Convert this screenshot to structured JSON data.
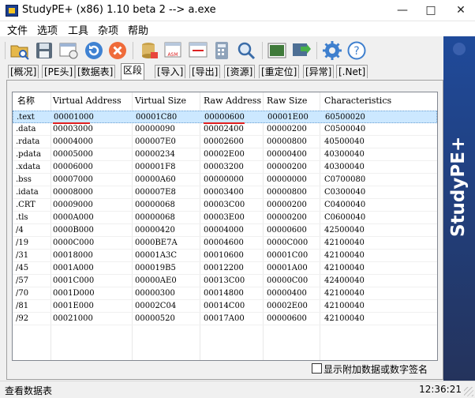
{
  "window": {
    "title": "StudyPE+ (x86) 1.10 beta 2  --> a.exe",
    "minimize": "—",
    "maximize": "□",
    "close": "✕"
  },
  "menu": [
    "文件",
    "选项",
    "工具",
    "杂项",
    "帮助"
  ],
  "toolbar": {
    "buttons": [
      {
        "name": "open-file",
        "icon": "folder-icon"
      },
      {
        "name": "save",
        "icon": "floppy-icon"
      },
      {
        "name": "view",
        "icon": "window-icon"
      },
      {
        "name": "reload",
        "icon": "refresh-icon"
      },
      {
        "name": "close-file",
        "icon": "close-circle-icon"
      },
      {
        "name": "database",
        "icon": "database-icon"
      },
      {
        "name": "disasm",
        "icon": "asm-icon"
      },
      {
        "name": "compare",
        "icon": "compare-icon"
      },
      {
        "name": "calculator",
        "icon": "calculator-icon"
      },
      {
        "name": "search",
        "icon": "search-icon"
      },
      {
        "name": "resource",
        "icon": "image-icon"
      },
      {
        "name": "convert",
        "icon": "convert-icon"
      },
      {
        "name": "settings",
        "icon": "gear-icon"
      },
      {
        "name": "help",
        "icon": "help-icon"
      }
    ]
  },
  "tabs": [
    "[概况]",
    "[PE头]",
    "[数据表]",
    "区段",
    "[导入]",
    "[导出]",
    "[资源]",
    "[重定位]",
    "[异常]",
    "[.Net]"
  ],
  "active_tab": "区段",
  "table": {
    "columns": [
      "名称",
      "Virtual Address",
      "Virtual Size",
      "Raw Address",
      "Raw Size",
      "Characteristics"
    ],
    "rows": [
      [
        ".text",
        "00001000",
        "00001C80",
        "00000600",
        "00001E00",
        "60500020"
      ],
      [
        ".data",
        "00003000",
        "00000090",
        "00002400",
        "00000200",
        "C0500040"
      ],
      [
        ".rdata",
        "00004000",
        "000007E0",
        "00002600",
        "00000800",
        "40500040"
      ],
      [
        ".pdata",
        "00005000",
        "00000234",
        "00002E00",
        "00000400",
        "40300040"
      ],
      [
        ".xdata",
        "00006000",
        "000001F8",
        "00003200",
        "00000200",
        "40300040"
      ],
      [
        ".bss",
        "00007000",
        "00000A60",
        "00000000",
        "00000000",
        "C0700080"
      ],
      [
        ".idata",
        "00008000",
        "000007E8",
        "00003400",
        "00000800",
        "C0300040"
      ],
      [
        ".CRT",
        "00009000",
        "00000068",
        "00003C00",
        "00000200",
        "C0400040"
      ],
      [
        ".tls",
        "0000A000",
        "00000068",
        "00003E00",
        "00000200",
        "C0600040"
      ],
      [
        "/4",
        "0000B000",
        "00000420",
        "00004000",
        "00000600",
        "42500040"
      ],
      [
        "/19",
        "0000C000",
        "0000BE7A",
        "00004600",
        "0000C000",
        "42100040"
      ],
      [
        "/31",
        "00018000",
        "00001A3C",
        "00010600",
        "00001C00",
        "42100040"
      ],
      [
        "/45",
        "0001A000",
        "000019B5",
        "00012200",
        "00001A00",
        "42100040"
      ],
      [
        "/57",
        "0001C000",
        "00000AE0",
        "00013C00",
        "00000C00",
        "42400040"
      ],
      [
        "/70",
        "0001D000",
        "00000300",
        "00014800",
        "00000400",
        "42100040"
      ],
      [
        "/81",
        "0001E000",
        "00002C04",
        "00014C00",
        "00002E00",
        "42100040"
      ],
      [
        "/92",
        "00021000",
        "00000520",
        "00017A00",
        "00000600",
        "42100040"
      ]
    ],
    "selected_row": 0
  },
  "checkbox": {
    "label": "显示附加数据或数字签名",
    "checked": false
  },
  "side_banner": "StudyPE+",
  "status": {
    "left": "查看数据表",
    "time": "12:36:21"
  },
  "colors": {
    "selection": "#cce8ff",
    "annotation": "#e21e1e",
    "banner": "#1f4a9a"
  }
}
